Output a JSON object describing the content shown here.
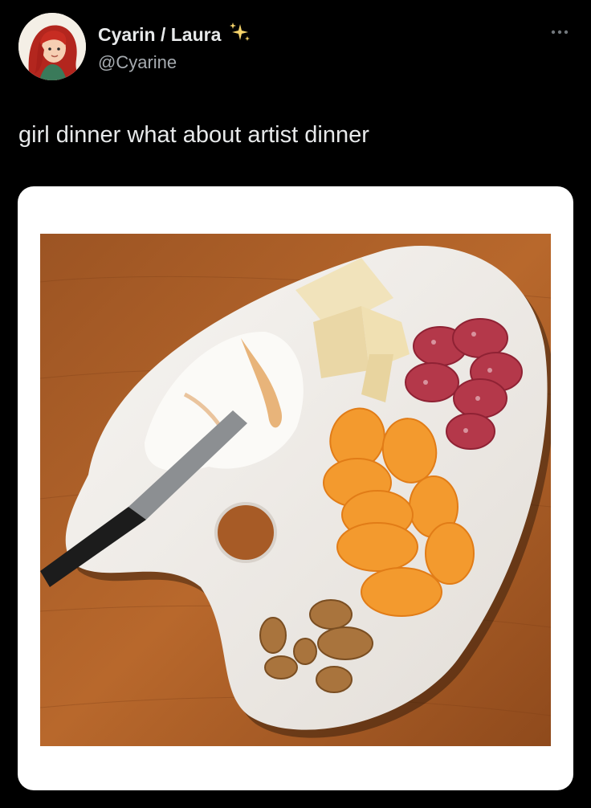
{
  "tweet": {
    "author": {
      "display_name": "Cyarin / Laura",
      "handle": "@Cyarine",
      "badge_icon": "sparkles-icon",
      "avatar_icon": "avatar-red-hair"
    },
    "more_icon": "more-options-icon",
    "text": "girl dinner what about artist dinner"
  },
  "colors": {
    "background": "#000000",
    "text_primary": "#e7e9ea",
    "text_secondary": "#a6abb0",
    "sparkle": "#f5d36a"
  }
}
